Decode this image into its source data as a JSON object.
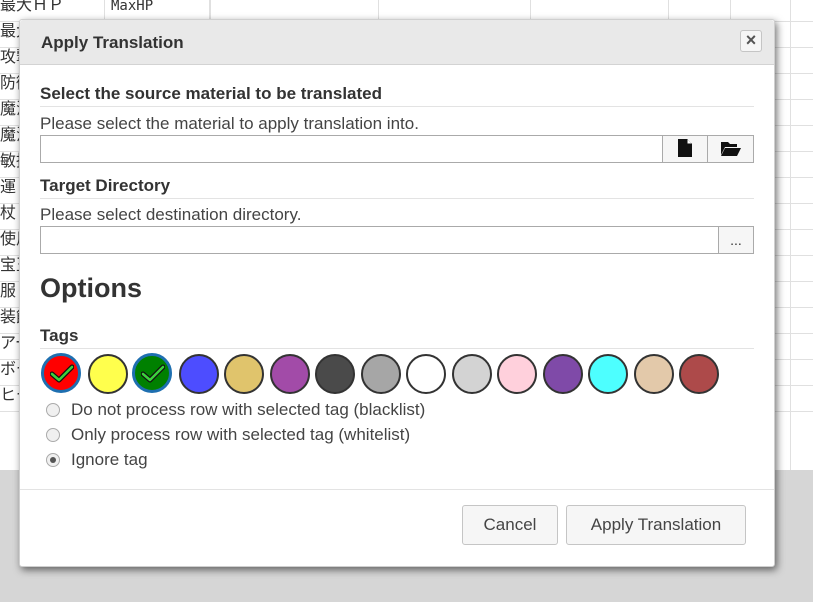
{
  "background_sheet": {
    "rows": [
      {
        "a": "最大ＨＰ",
        "b": "MaxHP"
      },
      {
        "a": "最大",
        "b": ""
      },
      {
        "a": "攻撃",
        "b": ""
      },
      {
        "a": "防御",
        "b": ""
      },
      {
        "a": "魔法",
        "b": ""
      },
      {
        "a": "魔法",
        "b": ""
      },
      {
        "a": "敏捷",
        "b": ""
      },
      {
        "a": "運",
        "b": ""
      },
      {
        "a": "杖",
        "b": ""
      },
      {
        "a": "使用",
        "b": ""
      },
      {
        "a": "宝玉",
        "b": ""
      },
      {
        "a": "服",
        "b": ""
      },
      {
        "a": "装飾",
        "b": ""
      },
      {
        "a": "アー",
        "b": ""
      },
      {
        "a": "ボー",
        "b": ""
      },
      {
        "a": "ヒー",
        "b": ""
      }
    ]
  },
  "dialog": {
    "title": "Apply Translation",
    "close_icon": "close-icon",
    "source": {
      "heading": "Select the source material to be translated",
      "description": "Please select the material to apply translation into.",
      "value": "",
      "file_icon": "file-icon",
      "folder_icon": "folder-open-icon"
    },
    "target": {
      "heading": "Target Directory",
      "description": "Please select destination directory.",
      "value": "",
      "browse_label": "..."
    },
    "options_heading": "Options",
    "tags": {
      "heading": "Tags",
      "colors": [
        {
          "color": "#ff0000",
          "selected": true
        },
        {
          "color": "#ffff4d",
          "selected": false
        },
        {
          "color": "#008000",
          "selected": true
        },
        {
          "color": "#4d4dff",
          "selected": false
        },
        {
          "color": "#e0c46c",
          "selected": false
        },
        {
          "color": "#a24ba8",
          "selected": false
        },
        {
          "color": "#4a4a4a",
          "selected": false
        },
        {
          "color": "#a6a6a6",
          "selected": false
        },
        {
          "color": "#ffffff",
          "selected": false
        },
        {
          "color": "#d3d3d3",
          "selected": false
        },
        {
          "color": "#ffd0dc",
          "selected": false
        },
        {
          "color": "#7f4aa8",
          "selected": false
        },
        {
          "color": "#4dffff",
          "selected": false
        },
        {
          "color": "#e3c9aa",
          "selected": false
        },
        {
          "color": "#ad4a4a",
          "selected": false
        }
      ],
      "modes": [
        {
          "label": "Do not process row with selected tag (blacklist)",
          "checked": false
        },
        {
          "label": "Only process row with selected tag (whitelist)",
          "checked": false
        },
        {
          "label": "Ignore tag",
          "checked": true
        }
      ]
    },
    "buttons": {
      "cancel": "Cancel",
      "apply": "Apply Translation"
    }
  }
}
